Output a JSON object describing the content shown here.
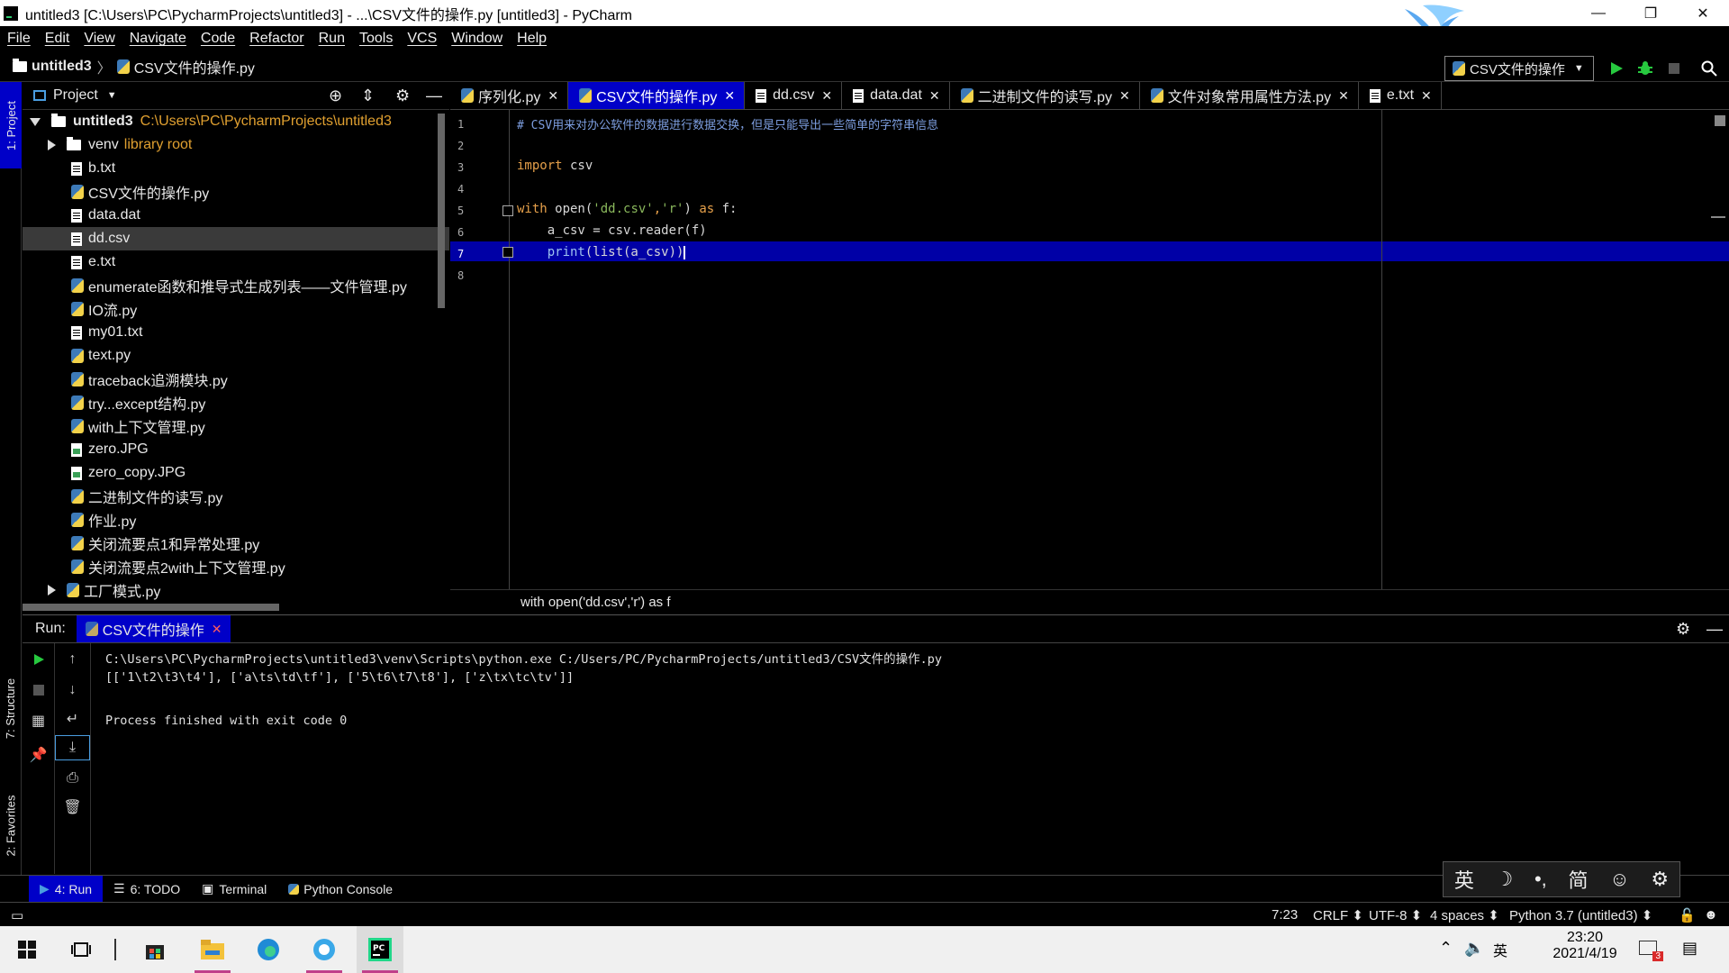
{
  "window": {
    "title": "untitled3 [C:\\Users\\PC\\PycharmProjects\\untitled3] - ...\\CSV文件的操作.py [untitled3] - PyCharm",
    "minimize": "—",
    "restore": "❐",
    "close": "✕"
  },
  "menu": [
    "File",
    "Edit",
    "View",
    "Navigate",
    "Code",
    "Refactor",
    "Run",
    "Tools",
    "VCS",
    "Window",
    "Help"
  ],
  "nav": {
    "project": "untitled3",
    "separator": "〉",
    "file": "CSV文件的操作.py",
    "run_config": "CSV文件的操作"
  },
  "side_tabs": {
    "project": "1: Project",
    "structure": "7: Structure",
    "favorites": "2: Favorites"
  },
  "project_panel": {
    "title": "Project",
    "root_name": "untitled3",
    "root_path": "C:\\Users\\PC\\PycharmProjects\\untitled3",
    "items": [
      {
        "name": "venv",
        "suffix": "library root",
        "type": "folder"
      },
      {
        "name": "b.txt",
        "type": "text"
      },
      {
        "name": "CSV文件的操作.py",
        "type": "py"
      },
      {
        "name": "data.dat",
        "type": "text"
      },
      {
        "name": "dd.csv",
        "type": "text"
      },
      {
        "name": "e.txt",
        "type": "text"
      },
      {
        "name": "enumerate函数和推导式生成列表——文件管理.py",
        "type": "py"
      },
      {
        "name": "IO流.py",
        "type": "py"
      },
      {
        "name": "my01.txt",
        "type": "text"
      },
      {
        "name": "text.py",
        "type": "py"
      },
      {
        "name": "traceback追溯模块.py",
        "type": "py"
      },
      {
        "name": "try...except结构.py",
        "type": "py"
      },
      {
        "name": "with上下文管理.py",
        "type": "py"
      },
      {
        "name": "zero.JPG",
        "type": "img"
      },
      {
        "name": "zero_copy.JPG",
        "type": "img"
      },
      {
        "name": "二进制文件的读写.py",
        "type": "py"
      },
      {
        "name": "作业.py",
        "type": "py"
      },
      {
        "name": "关闭流要点1和异常处理.py",
        "type": "py"
      },
      {
        "name": "关闭流要点2with上下文管理.py",
        "type": "py"
      },
      {
        "name": "工厂模式.py",
        "type": "py"
      }
    ]
  },
  "tabs": [
    {
      "label": "序列化.py",
      "type": "py",
      "active": false
    },
    {
      "label": "CSV文件的操作.py",
      "type": "py",
      "active": true
    },
    {
      "label": "dd.csv",
      "type": "text",
      "active": false
    },
    {
      "label": "data.dat",
      "type": "text",
      "active": false
    },
    {
      "label": "二进制文件的读写.py",
      "type": "py",
      "active": false
    },
    {
      "label": "文件对象常用属性方法.py",
      "type": "py",
      "active": false
    },
    {
      "label": "e.txt",
      "type": "text",
      "active": false
    }
  ],
  "editor": {
    "line_numbers": [
      "1",
      "2",
      "3",
      "4",
      "5",
      "6",
      "7",
      "8"
    ],
    "comment": "# CSV用来对办公软件的数据进行数据交换，但是只能导出一些简单的字符串信息",
    "code": {
      "import_kw": "import",
      "import_mod": " csv",
      "with_kw": "with",
      "open_call": " open(",
      "open_arg1": "'dd.csv'",
      "comma": ",",
      "open_arg2": "'r'",
      "close_paren": ") ",
      "as_kw": "as",
      "f_colon": " f:",
      "line6": "    a_csv = csv.reader(f)",
      "print_fn": "    print",
      "print_args": "(list(a_csv))"
    },
    "breadcrumb": "with open('dd.csv','r') as f"
  },
  "run_panel": {
    "label": "Run:",
    "tab": "CSV文件的操作",
    "console": [
      "C:\\Users\\PC\\PycharmProjects\\untitled3\\venv\\Scripts\\python.exe C:/Users/PC/PycharmProjects/untitled3/CSV文件的操作.py",
      "[['1\\t2\\t3\\t4'], ['a\\ts\\td\\tf'], ['5\\t6\\t7\\t8'], ['z\\tx\\tc\\tv']]",
      "",
      "Process finished with exit code 0"
    ]
  },
  "tool_windows": [
    {
      "label": "4: Run",
      "active": true
    },
    {
      "label": "6: TODO",
      "active": false
    },
    {
      "label": "Terminal",
      "active": false
    },
    {
      "label": "Python Console",
      "active": false
    }
  ],
  "status": {
    "position": "7:23",
    "line_sep": "CRLF ⬍",
    "encoding": "UTF-8 ⬍",
    "indent": "4 spaces ⬍",
    "interpreter": "Python 3.7 (untitled3) ⬍"
  },
  "ime": [
    "英",
    "☽",
    "•,",
    "简",
    "☺",
    "⚙"
  ],
  "taskbar": {
    "lang": "英",
    "time": "23:20",
    "date": "2021/4/19",
    "notif_count": "3"
  },
  "colors": {
    "accent_blue": "#0000c8",
    "run_green": "#27c93f",
    "keyword": "#e6a04a",
    "string": "#8ab85c",
    "comment": "#7d9ee0"
  }
}
